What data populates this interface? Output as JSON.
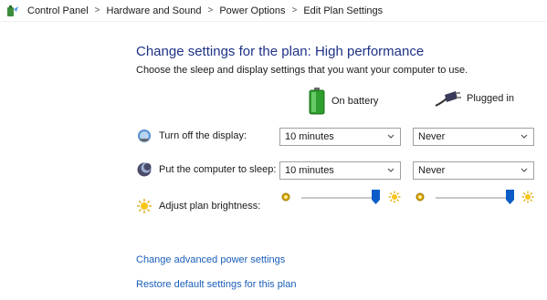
{
  "breadcrumb": {
    "icon": "power-options-icon",
    "items": [
      "Control Panel",
      "Hardware and Sound",
      "Power Options",
      "Edit Plan Settings"
    ],
    "separator": ">"
  },
  "heading": {
    "title": "Change settings for the plan: High performance",
    "subtitle": "Choose the sleep and display settings that you want your computer to use."
  },
  "columns": {
    "battery": {
      "label": "On battery",
      "icon": "battery-icon"
    },
    "plugged": {
      "label": "Plugged in",
      "icon": "power-plug-icon"
    }
  },
  "settings": {
    "display": {
      "label": "Turn off the display:",
      "icon": "monitor-icon",
      "battery_value": "10 minutes",
      "plugged_value": "Never"
    },
    "sleep": {
      "label": "Put the computer to sleep:",
      "icon": "sleep-moon-icon",
      "battery_value": "10 minutes",
      "plugged_value": "Never"
    },
    "brightness": {
      "label": "Adjust plan brightness:",
      "icon": "brightness-sun-icon",
      "battery_level": 1.0,
      "plugged_level": 1.0
    }
  },
  "links": {
    "advanced": "Change advanced power settings",
    "restore": "Restore default settings for this plan"
  },
  "colors": {
    "title": "#1e3287",
    "link": "#1a5eb8",
    "slider_thumb": "#0b5cc7"
  }
}
